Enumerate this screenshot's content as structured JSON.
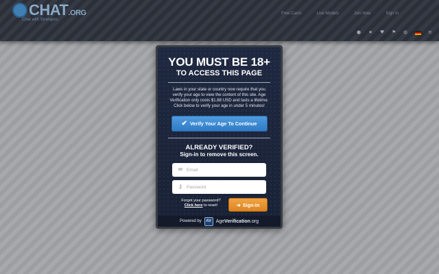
{
  "site": {
    "logo_text": "CHAT",
    "logo_suffix": ".ORG",
    "tagline": "Chat with Strangers",
    "nav": [
      "Free Cams",
      "Live Models",
      "Join Now",
      "Sign In"
    ],
    "icons": [
      "user-icon",
      "star-icon",
      "heart-icon",
      "flag-icon",
      "globe-icon",
      "german-flag-icon",
      "menu-icon"
    ]
  },
  "modal": {
    "title_line1": "YOU MUST BE 18+",
    "title_line2": "TO ACCESS THIS PAGE",
    "body": "Laws in your state or country now require that you verify your age to view the content of this site. Age Verification only costs $1.88 USD and lasts a lifetime. Click below to verify your age in under 5 minutes!",
    "verify_button": "Verify Your Age To Continue",
    "verified_heading": "ALREADY VERIFIED?",
    "verified_sub": "Sign-in to remove this screen.",
    "email_placeholder": "Email",
    "password_placeholder": "Password",
    "forgot_text": "Forgot your password?",
    "click_here": "Click here",
    "to_reset": " to reset!",
    "signin_button": "Sign-In",
    "powered_by": "Powered by",
    "brand_age": "Age",
    "brand_verification": "Verification",
    "brand_org": ".org",
    "colors": {
      "verify_button": "#3a8ad4",
      "signin_button": "#e8922f",
      "panel": "#1d263c"
    }
  }
}
